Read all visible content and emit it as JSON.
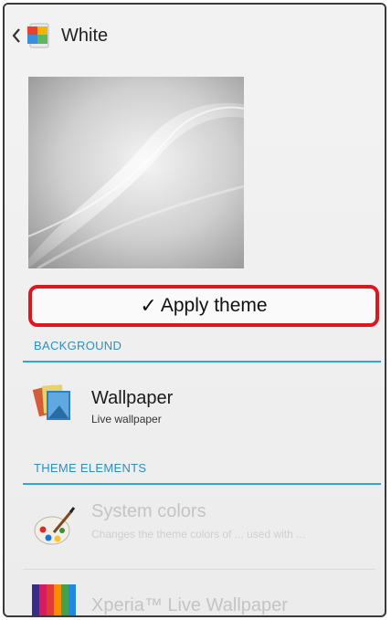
{
  "actionbar": {
    "title": "White",
    "back_icon": "chevron-left-icon",
    "app_icon": "themes-app-icon"
  },
  "preview": {
    "description_icon": "theme-preview-image"
  },
  "apply_button": {
    "check_glyph": "✓",
    "label": "Apply theme"
  },
  "sections": [
    {
      "header": "BACKGROUND",
      "items": [
        {
          "title": "Wallpaper",
          "subtitle": "Live wallpaper",
          "icon": "wallpaper-icon",
          "enabled": true
        }
      ]
    },
    {
      "header": "THEME ELEMENTS",
      "items": [
        {
          "title": "System colors",
          "subtitle": "Changes the theme colors of ... used with ...",
          "icon": "palette-icon",
          "enabled": false
        },
        {
          "title": "Xperia™ Live Wallpaper",
          "subtitle": "",
          "icon": "live-wallpaper-icon",
          "enabled": false
        }
      ]
    }
  ],
  "colors": {
    "accent": "#33a4d6",
    "highlight_border": "#e0161e"
  }
}
